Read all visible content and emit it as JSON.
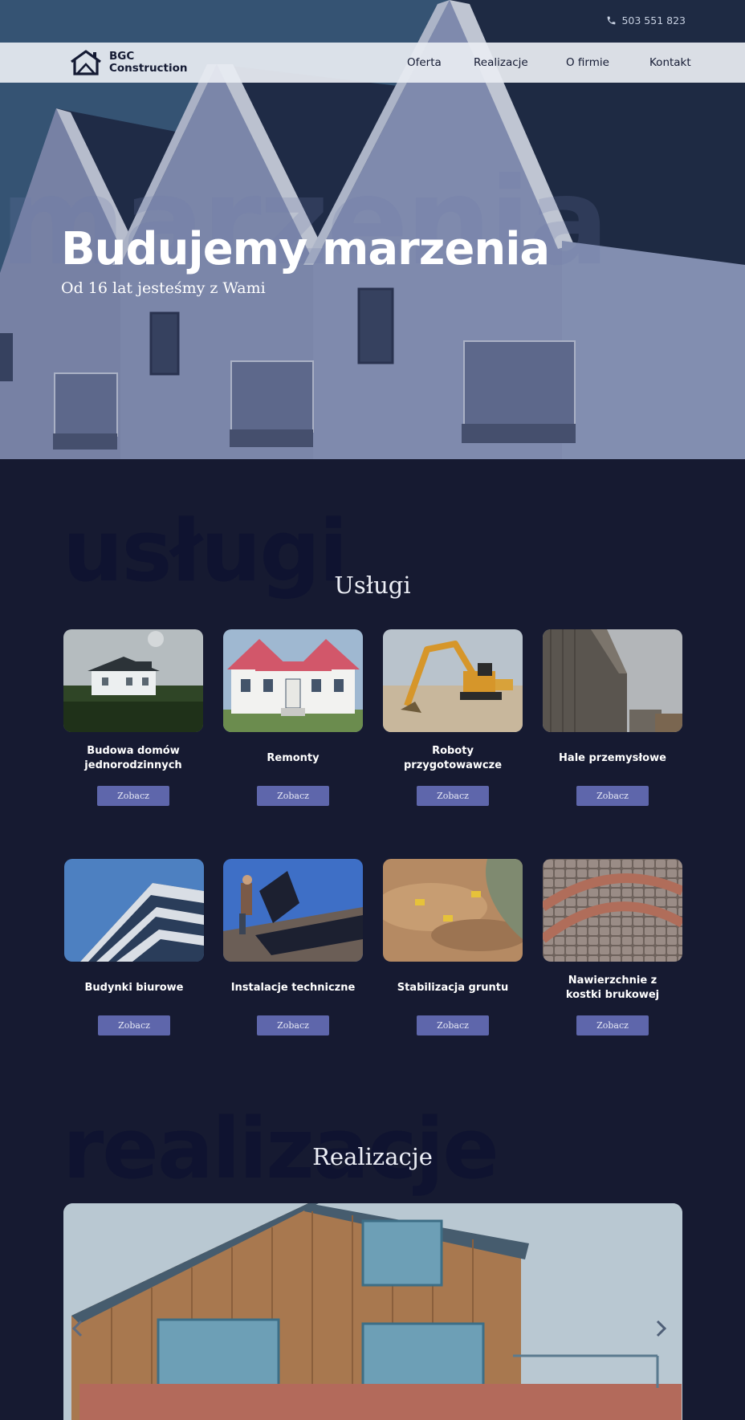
{
  "header": {
    "phone": "503 551 823",
    "brand_line1": "BGC",
    "brand_line2": "Construction",
    "nav": [
      "Oferta",
      "Realizacje",
      "O firmie",
      "Kontakt"
    ]
  },
  "hero": {
    "background_word": "marzenia",
    "title": "Budujemy marzenia",
    "subtitle": "Od 16 lat jesteśmy z Wami"
  },
  "services": {
    "background_word": "usługi",
    "title": "Usługi",
    "items": [
      {
        "label": "Budowa domów jednorodzinnych",
        "button": "Zobacz"
      },
      {
        "label": "Remonty",
        "button": "Zobacz"
      },
      {
        "label": "Roboty przygotowawcze",
        "button": "Zobacz"
      },
      {
        "label": "Hale przemysłowe",
        "button": "Zobacz"
      },
      {
        "label": "Budynki biurowe",
        "button": "Zobacz"
      },
      {
        "label": "Instalacje techniczne",
        "button": "Zobacz"
      },
      {
        "label": "Stabilizacja gruntu",
        "button": "Zobacz"
      },
      {
        "label": "Nawierzchnie z kostki brukowej",
        "button": "Zobacz"
      }
    ]
  },
  "projects": {
    "background_word": "realizacje",
    "title": "Realizacje",
    "prev_icon": "chevron-left-icon",
    "next_icon": "chevron-right-icon"
  },
  "colors": {
    "background": "#161a31",
    "button": "#5e66ab",
    "navbar": "#e8ecf2"
  }
}
